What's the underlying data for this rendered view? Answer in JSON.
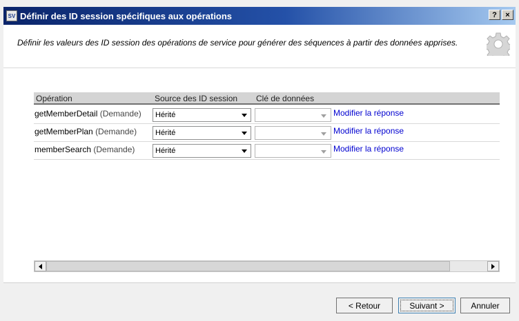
{
  "window": {
    "app_icon_text": "SV",
    "title": "Définir des ID session spécifiques aux opérations",
    "help_button": "?",
    "close_button": "×"
  },
  "header": {
    "description": "Définir les valeurs des ID session des opérations de service pour générer des séquences à partir des données apprises.",
    "icon": "gear-icon"
  },
  "grid": {
    "columns": [
      "Opération",
      "Source des ID session",
      "Clé de données"
    ],
    "rows": [
      {
        "operation": "getMemberDetail",
        "type": "(Demande)",
        "source": "Hérité",
        "key": "",
        "link": "Modifier la réponse"
      },
      {
        "operation": "getMemberPlan",
        "type": "(Demande)",
        "source": "Hérité",
        "key": "",
        "link": "Modifier la réponse"
      },
      {
        "operation": "memberSearch",
        "type": "(Demande)",
        "source": "Hérité",
        "key": "",
        "link": "Modifier la réponse"
      }
    ]
  },
  "footer": {
    "back": "< Retour",
    "next": "Suivant >",
    "cancel": "Annuler"
  },
  "colors": {
    "title_gradient_start": "#0a246a",
    "title_gradient_end": "#a6caf0",
    "link": "#0000d0"
  }
}
